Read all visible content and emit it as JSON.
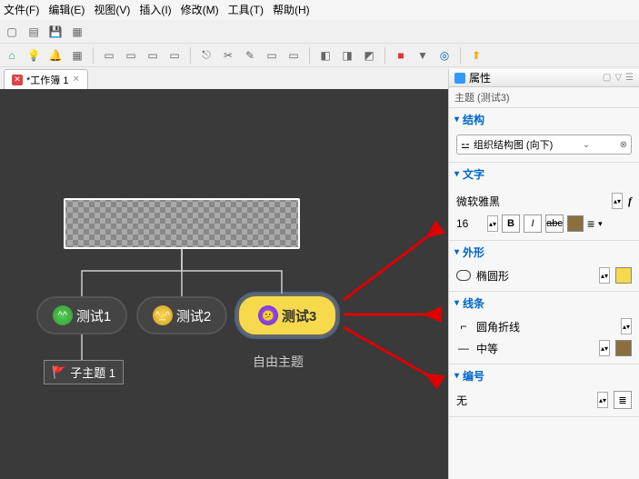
{
  "menu": {
    "file": "文件(F)",
    "edit": "编辑(E)",
    "view": "视图(V)",
    "insert": "插入(I)",
    "modify": "修改(M)",
    "tools": "工具(T)",
    "help": "帮助(H)"
  },
  "tab": {
    "title": "*工作簿 1",
    "close": "✕"
  },
  "canvas": {
    "child1": "测试1",
    "child2": "测试2",
    "child3": "测试3",
    "subtopic": "子主题 1",
    "free_topic": "自由主题"
  },
  "panel": {
    "title": "属性",
    "subtitle": "主题 (测试3)",
    "struct": {
      "header": "结构",
      "value": "组织结构图 (向下)"
    },
    "text": {
      "header": "文字",
      "font": "微软雅黑",
      "size": "16",
      "bold": "B",
      "italic": "I",
      "strike": "abc"
    },
    "shape": {
      "header": "外形",
      "value": "椭圆形"
    },
    "line": {
      "header": "线条",
      "style": "圆角折线",
      "weight": "中等"
    },
    "numbering": {
      "header": "编号",
      "value": "无"
    }
  }
}
